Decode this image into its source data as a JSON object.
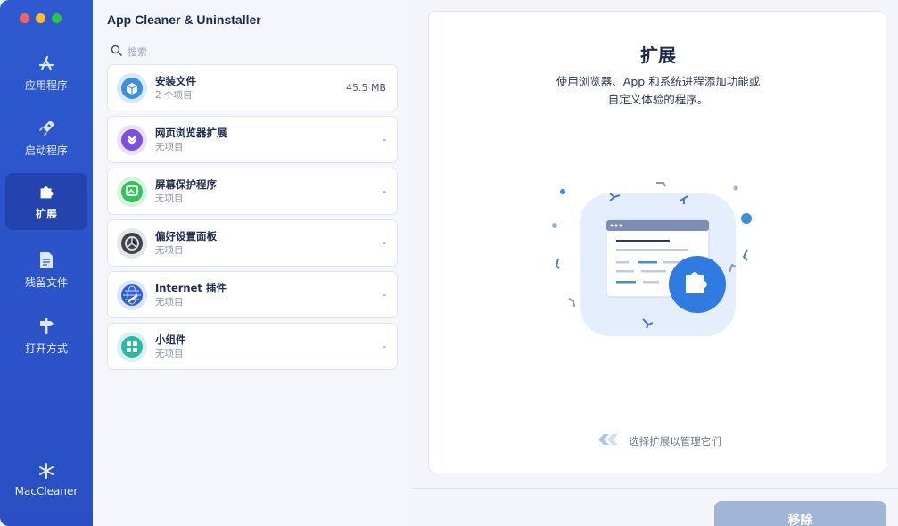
{
  "window": {
    "title": "App Cleaner & Uninstaller"
  },
  "sidebar": {
    "items": [
      {
        "label": "应用程序",
        "icon": "app-store-icon"
      },
      {
        "label": "启动程序",
        "icon": "rocket-icon"
      },
      {
        "label": "扩展",
        "icon": "puzzle-icon",
        "active": true
      },
      {
        "label": "残留文件",
        "icon": "document-icon"
      },
      {
        "label": "打开方式",
        "icon": "signpost-icon"
      }
    ],
    "bottom_label": "MacCleaner"
  },
  "search": {
    "placeholder": "搜索"
  },
  "categories": [
    {
      "name": "安装文件",
      "sub": "2 个项目",
      "size": "45.5 MB",
      "icon": "installer-box-icon"
    },
    {
      "name": "网页浏览器扩展",
      "sub": "无项目",
      "size": "-",
      "icon": "browser-extension-icon"
    },
    {
      "name": "屏幕保护程序",
      "sub": "无项目",
      "size": "-",
      "icon": "screensaver-icon"
    },
    {
      "name": "偏好设置面板",
      "sub": "无项目",
      "size": "-",
      "icon": "preferences-gear-icon"
    },
    {
      "name": "Internet 插件",
      "sub": "无项目",
      "size": "-",
      "icon": "internet-globe-icon"
    },
    {
      "name": "小组件",
      "sub": "无项目",
      "size": "-",
      "icon": "widgets-icon"
    }
  ],
  "detail": {
    "title": "扩展",
    "description_line1": "使用浏览器、App 和系统进程添加功能或",
    "description_line2": "自定义体验的程序。",
    "hint": "选择扩展以管理它们"
  },
  "actions": {
    "remove_label": "移除"
  },
  "colors": {
    "accent": "#2e59cf",
    "sidebar_active": "#2344ad",
    "remove_disabled": "#9fb6d6"
  }
}
